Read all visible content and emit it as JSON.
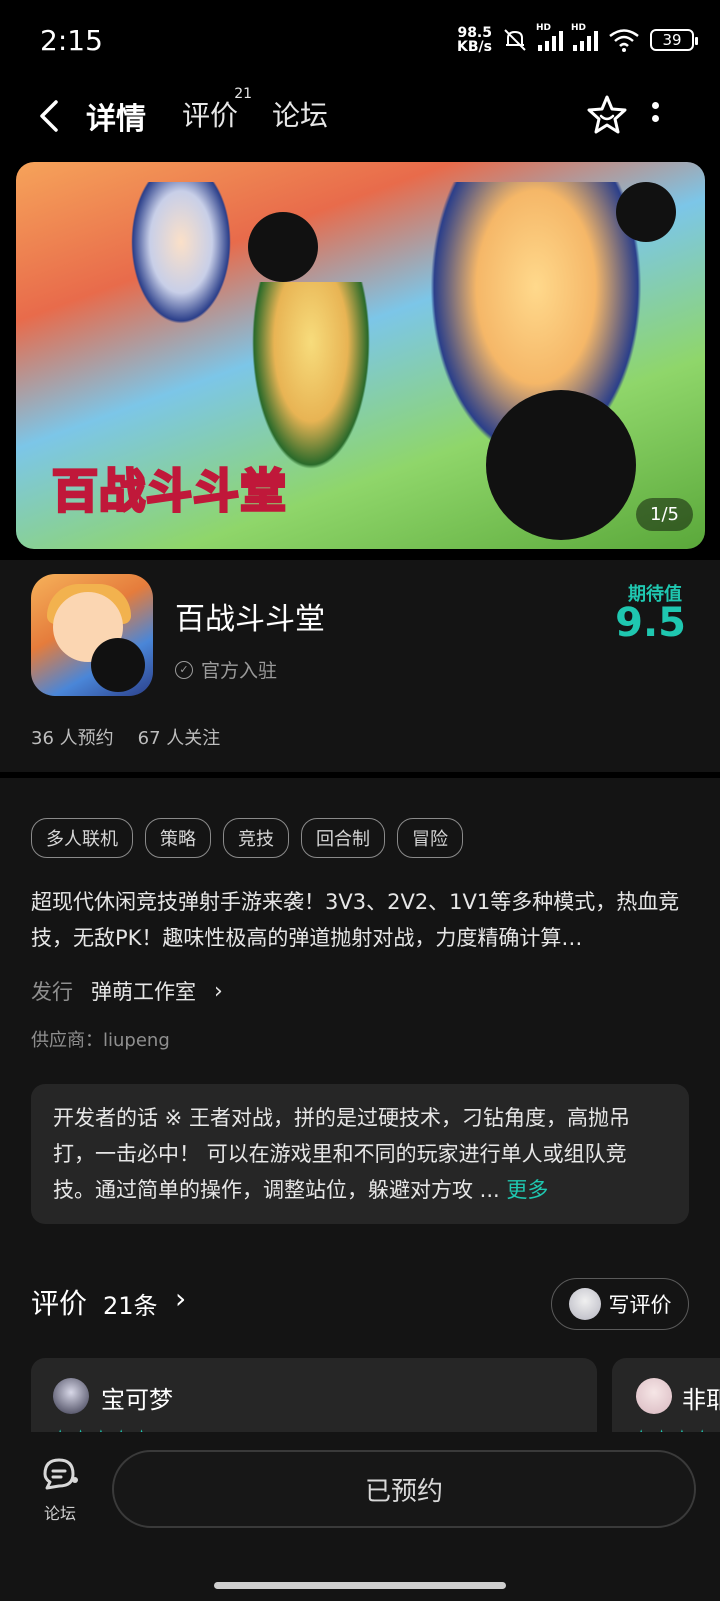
{
  "status_bar": {
    "time": "2:15",
    "net_speed": "98.5",
    "net_unit": "KB/s",
    "battery": "39"
  },
  "nav": {
    "tabs": [
      {
        "label": "详情",
        "active": true
      },
      {
        "label": "评价",
        "badge": "21"
      },
      {
        "label": "论坛"
      }
    ]
  },
  "banner": {
    "logo_text": "百战斗斗堂",
    "counter": "1/5"
  },
  "app": {
    "name": "百战斗斗堂",
    "official": "官方入驻",
    "expect_label": "期待值",
    "expect_score": "9.5",
    "reservations": "36 人预约",
    "followers": "67 人关注"
  },
  "tags": [
    "多人联机",
    "策略",
    "竞技",
    "回合制",
    "冒险"
  ],
  "description": "超现代休闲竞技弹射手游来袭！3V3、2V2、1V1等多种模式，热血竞技，无敌PK！趣味性极高的弹道抛射对战，力度精确计算…",
  "publisher": {
    "label": "发行",
    "value": "弹萌工作室"
  },
  "supplier": "供应商：liupeng",
  "dev_words": {
    "text": "开发者的话 ※ 王者对战，拼的是过硬技术，刁钻角度，高抛吊打，一击必中！ 可以在游戏里和不同的玩家进行单人或组队竞技。通过简单的操作，调整站位，躲避对方攻 ...",
    "more": "更多"
  },
  "reviews": {
    "title": "评价",
    "count": "21条",
    "write_label": "写评价",
    "cards": [
      {
        "name": "宝可梦"
      },
      {
        "name": "非耶"
      }
    ]
  },
  "bottom": {
    "forum_label": "论坛",
    "reserve_label": "已预约"
  },
  "colors": {
    "accent": "#1fc7b0",
    "background": "#141414",
    "card": "#262626"
  }
}
